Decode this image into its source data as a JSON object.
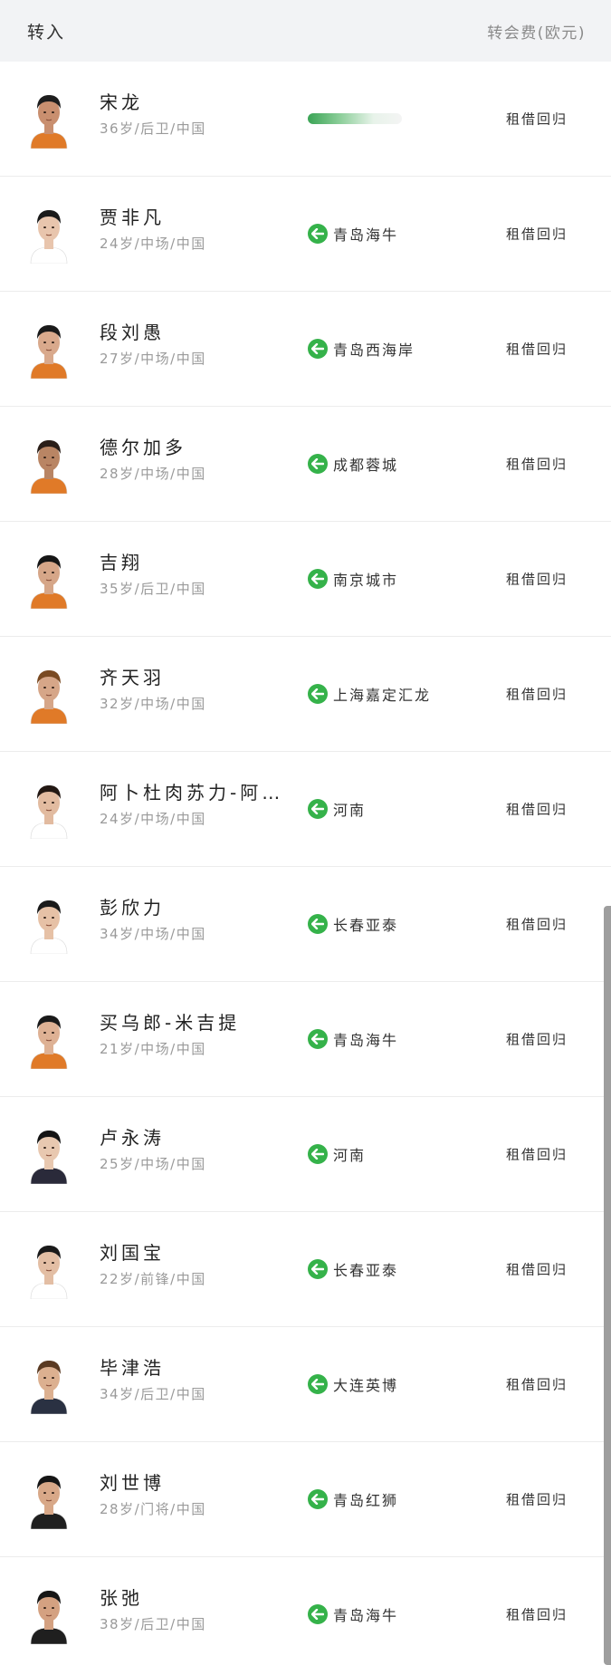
{
  "header": {
    "title": "转入",
    "fee_label": "转会费(欧元)"
  },
  "players": [
    {
      "name": "宋龙",
      "meta": "36岁/后卫/中国",
      "from": "",
      "fee": "租借回归",
      "skin": "#c98f6f",
      "hair": "#1d1d1d",
      "shirt": "#e07a28"
    },
    {
      "name": "贾非凡",
      "meta": "24岁/中场/中国",
      "from": "青岛海牛",
      "fee": "租借回归",
      "skin": "#e8c5ad",
      "hair": "#1a1a1a",
      "shirt": "#ffffff"
    },
    {
      "name": "段刘愚",
      "meta": "27岁/中场/中国",
      "from": "青岛西海岸",
      "fee": "租借回归",
      "skin": "#d9a98c",
      "hair": "#1a1a1a",
      "shirt": "#e07a28"
    },
    {
      "name": "德尔加多",
      "meta": "28岁/中场/中国",
      "from": "成都蓉城",
      "fee": "租借回归",
      "skin": "#b98564",
      "hair": "#2a1e18",
      "shirt": "#e07a28"
    },
    {
      "name": "吉翔",
      "meta": "35岁/后卫/中国",
      "from": "南京城市",
      "fee": "租借回归",
      "skin": "#d6a688",
      "hair": "#161616",
      "shirt": "#e07a28"
    },
    {
      "name": "齐天羽",
      "meta": "32岁/中场/中国",
      "from": "上海嘉定汇龙",
      "fee": "租借回归",
      "skin": "#d6a688",
      "hair": "#7a4a22",
      "shirt": "#e07a28"
    },
    {
      "name": "阿卜杜肉苏力-阿…",
      "meta": "24岁/中场/中国",
      "from": "河南",
      "fee": "租借回归",
      "skin": "#e2bba0",
      "hair": "#231813",
      "shirt": "#ffffff"
    },
    {
      "name": "彭欣力",
      "meta": "34岁/中场/中国",
      "from": "长春亚泰",
      "fee": "租借回归",
      "skin": "#e6c1a6",
      "hair": "#1a1a1a",
      "shirt": "#ffffff"
    },
    {
      "name": "买乌郎-米吉提",
      "meta": "21岁/中场/中国",
      "from": "青岛海牛",
      "fee": "租借回归",
      "skin": "#deb194",
      "hair": "#1a1a1a",
      "shirt": "#e07a28"
    },
    {
      "name": "卢永涛",
      "meta": "25岁/中场/中国",
      "from": "河南",
      "fee": "租借回归",
      "skin": "#e8c8b0",
      "hair": "#141414",
      "shirt": "#2a2a3a"
    },
    {
      "name": "刘国宝",
      "meta": "22岁/前锋/中国",
      "from": "长春亚泰",
      "fee": "租借回归",
      "skin": "#e3bea4",
      "hair": "#1a1a1a",
      "shirt": "#ffffff"
    },
    {
      "name": "毕津浩",
      "meta": "34岁/后卫/中国",
      "from": "大连英博",
      "fee": "租借回归",
      "skin": "#dcb090",
      "hair": "#5a3a22",
      "shirt": "#2a3142"
    },
    {
      "name": "刘世博",
      "meta": "28岁/门将/中国",
      "from": "青岛红狮",
      "fee": "租借回归",
      "skin": "#d8a888",
      "hair": "#151515",
      "shirt": "#1f1f1f"
    },
    {
      "name": "张弛",
      "meta": "38岁/后卫/中国",
      "from": "青岛海牛",
      "fee": "租借回归",
      "skin": "#d4a181",
      "hair": "#161616",
      "shirt": "#1f1f1f"
    }
  ]
}
